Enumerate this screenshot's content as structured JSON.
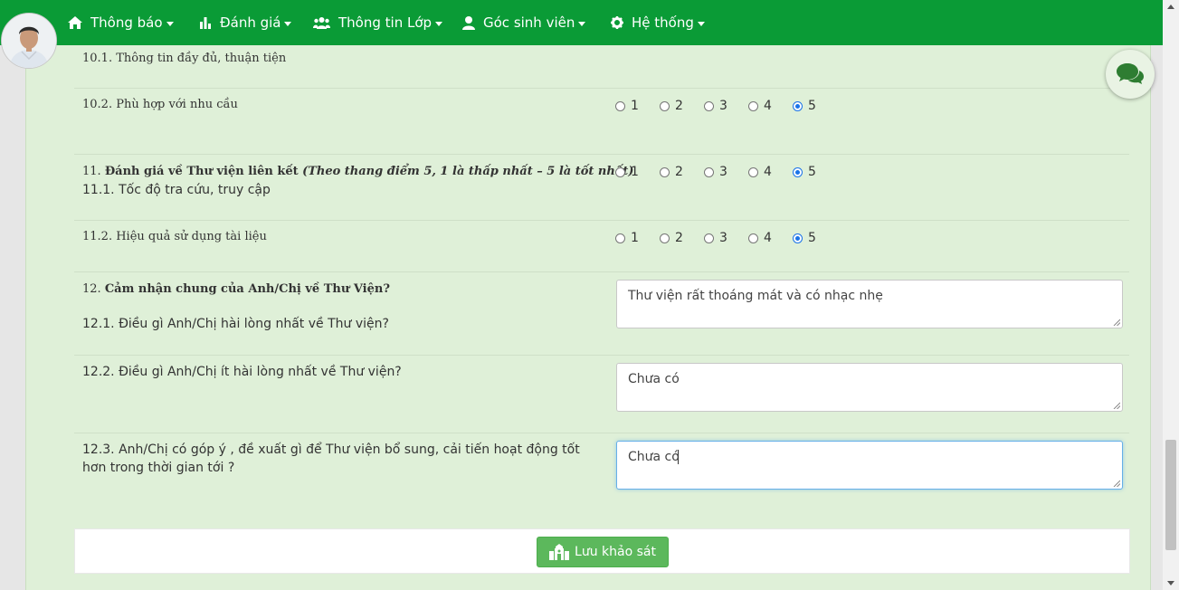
{
  "nav": {
    "items": [
      {
        "label": "Thông báo",
        "icon": "home-icon",
        "caret": true
      },
      {
        "label": "Đánh giá",
        "icon": "bar-chart-icon",
        "caret": true
      },
      {
        "label": "Thông tin Lớp",
        "icon": "users-icon",
        "caret": true
      },
      {
        "label": "Góc sinh viên",
        "icon": "user-icon",
        "caret": true
      },
      {
        "label": "Hệ thống",
        "icon": "gear-icon",
        "caret": true
      }
    ]
  },
  "survey": {
    "q10_1": "10.1. Thông tin đầy đủ, thuận tiện",
    "q10_2": "10.2. Phù hợp với nhu cầu",
    "q11_prefix": "11. ",
    "q11_title": "Đánh giá về Thư viện liên kết",
    "q11_note": "(Theo thang điểm 5, 1 là thấp nhất – 5 là tốt nhất)",
    "q11_1": "11.1. Tốc độ tra cứu, truy cập",
    "q11_2": "11.2. Hiệu quả sử dụng tài liệu",
    "q12_prefix": "12. ",
    "q12_title": "Cảm nhận chung của Anh/Chị về Thư Viện?",
    "q12_1": "12.1. Điều gì Anh/Chị hài lòng nhất về Thư viện?",
    "q12_2": "12.2. Điều gì Anh/Chị ít hài lòng nhất về Thư viện?",
    "q12_3": "12.3. Anh/Chị có góp ý , đề xuất gì để Thư viện bổ sung, cải tiến hoạt động tốt hơn trong thời gian tới ?",
    "rating_options": [
      "1",
      "2",
      "3",
      "4",
      "5"
    ],
    "q10_2_selected": "5",
    "q11_1_selected": "5",
    "q11_2_selected": "5",
    "a12_1": "Thư viện rất thoáng mát và có nhạc nhẹ",
    "a12_2": "Chưa có",
    "a12_3": "Chưa có"
  },
  "actions": {
    "save_label": "Lưu khảo sát"
  },
  "colors": {
    "navbar": "#0a9b36",
    "panel": "#dff0d8",
    "save_button": "#5cb85c",
    "radio_checked": "#1a73e8"
  }
}
